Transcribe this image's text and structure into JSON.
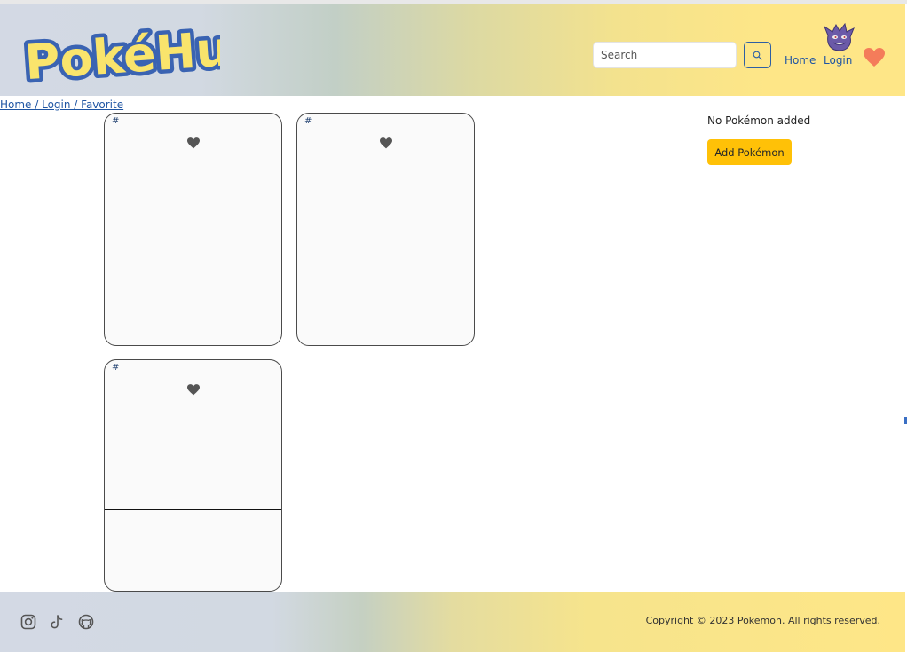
{
  "header": {
    "logo_text": "PokéHub",
    "search": {
      "placeholder": "Search",
      "value": ""
    },
    "search_button_icon": "search-icon",
    "nav": {
      "home": "Home",
      "login": "Login"
    },
    "avatar_icon": "gengar-icon",
    "favorites_icon": "heart-icon"
  },
  "breadcrumb": "Home / Login / Favorite",
  "cards": [
    {
      "number": "#",
      "heart_icon": "heart-icon"
    },
    {
      "number": "#",
      "heart_icon": "heart-icon"
    },
    {
      "number": "#",
      "heart_icon": "heart-icon"
    }
  ],
  "sidebar": {
    "empty_message": "No Pokémon added",
    "add_button": "Add Pokémon"
  },
  "footer": {
    "social_icons": [
      "instagram-icon",
      "tiktok-icon",
      "github-icon"
    ],
    "copyright": "Copyright © 2023 Pokemon. All rights reserved."
  },
  "colors": {
    "accent_button": "#ffc107",
    "link": "#1f55a3",
    "favorite_heart": "#f47c5a",
    "header_gradient_start": "#d3d9e4",
    "header_gradient_end": "#fee687"
  }
}
